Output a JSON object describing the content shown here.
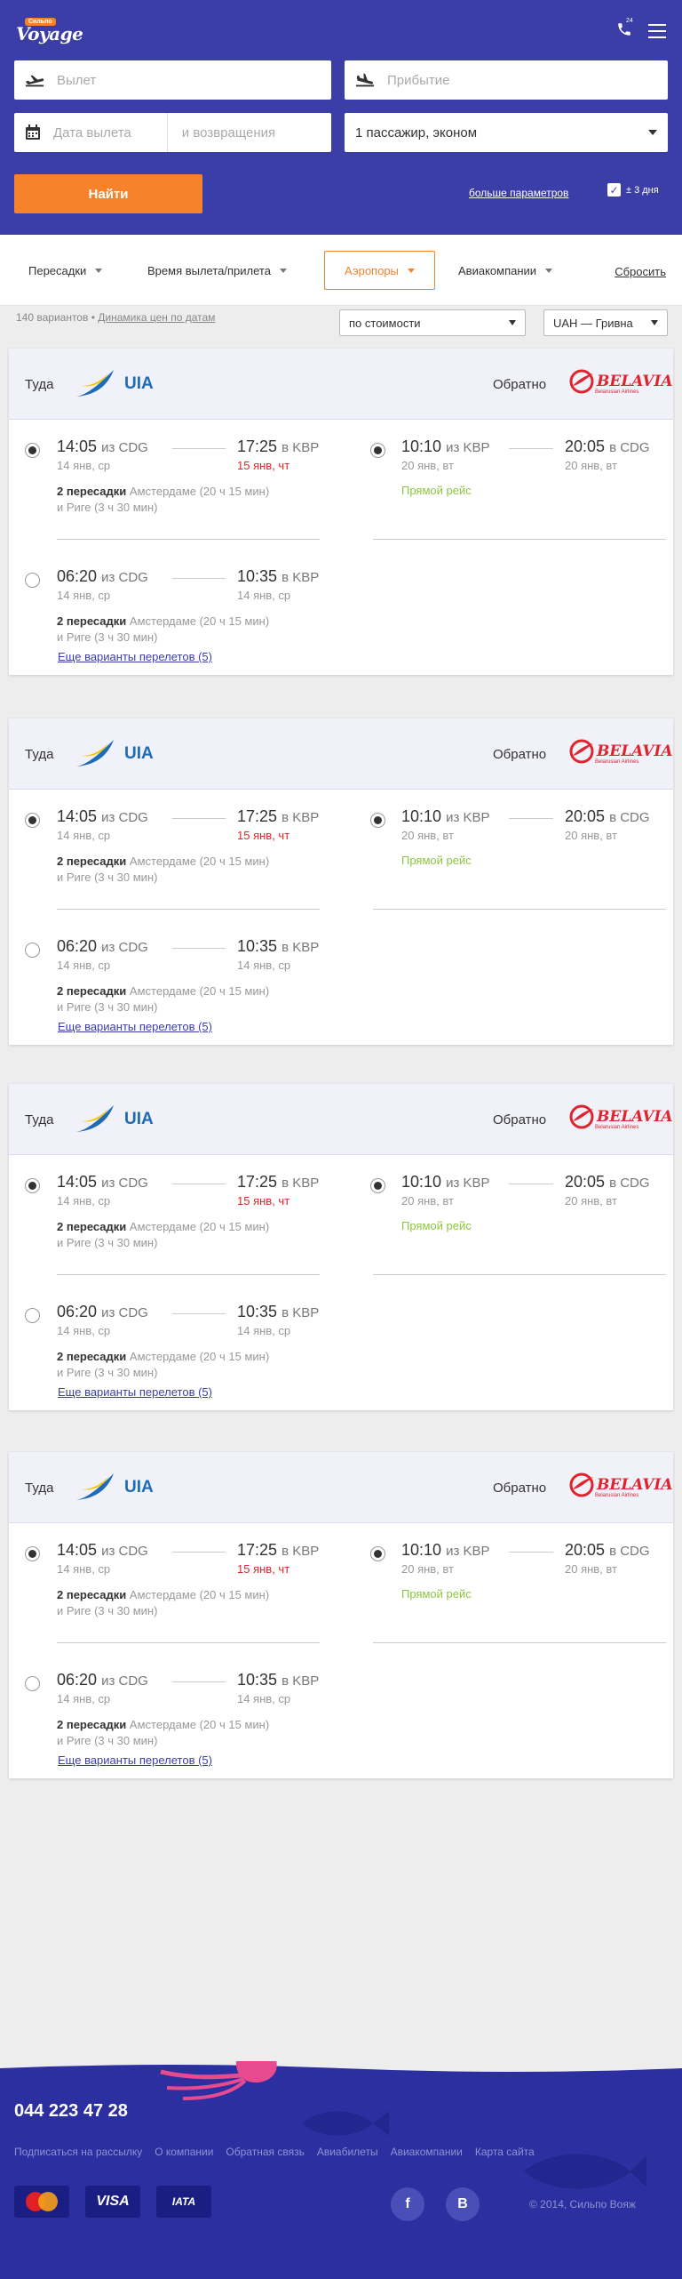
{
  "header": {
    "logo_text": "Voyage",
    "logo_flag": "Сильпо",
    "phone_badge": "24",
    "depart_placeholder": "Вылет",
    "arrive_placeholder": "Прибытие",
    "date_from_placeholder": "Дата вылета",
    "date_back_placeholder": "и возвращения",
    "passengers_value": "1 пассажир, эконом",
    "find_label": "Найти",
    "more_params_label": "больше параметров",
    "plus_minus_label": "± 3 дня"
  },
  "filters": {
    "items": [
      "Пересадки",
      "Время вылета/прилета",
      "Аэропоры",
      "Авиакомпании"
    ],
    "active_index": 2,
    "reset_label": "Сбросить"
  },
  "results": {
    "count_text": "140 вариантов",
    "dynamics_link": "Динамика цен по датам",
    "sort_value": "по стоимости",
    "currency_value": "UAH — Гривна"
  },
  "cards": [
    {
      "there_label": "Туда",
      "back_label": "Обратно",
      "airline_out": "UIA",
      "airline_back": "BELAVIA",
      "airline_back_sub": "Belarusian Airlines",
      "flight_a": {
        "dep_time": "14:05",
        "dep_from": "из CDG",
        "dep_date": "14 янв, ср",
        "arr_time": "17:25",
        "arr_to": "в KBP",
        "arr_date": "15 янв, чт",
        "stops_bold": "2 пересадки",
        "stops_text": "Амстердаме (20 ч  15 мин)",
        "stops_text2": "и Риге (3 ч 30 мин)"
      },
      "flight_b": {
        "dep_time": "06:20",
        "dep_from": "из CDG",
        "dep_date": "14 янв, ср",
        "arr_time": "10:35",
        "arr_to": "в KBP",
        "arr_date": "14 янв, ср",
        "stops_bold": "2 пересадки",
        "stops_text": "Амстердаме (20 ч  15 мин)",
        "stops_text2": "и Риге (3 ч 30 мин)"
      },
      "return": {
        "dep_time": "10:10",
        "dep_from": "из KBP",
        "dep_date": "20 янв, вт",
        "arr_time": "20:05",
        "arr_to": "в CDG",
        "arr_date": "20 янв, вт",
        "direct": "Прямой рейс"
      },
      "more_link": "Еще варианты перелетов (5)"
    },
    {
      "there_label": "Туда",
      "back_label": "Обратно",
      "airline_out": "UIA",
      "airline_back": "BELAVIA",
      "airline_back_sub": "Belarusian Airlines",
      "flight_a": {
        "dep_time": "14:05",
        "dep_from": "из CDG",
        "dep_date": "14 янв, ср",
        "arr_time": "17:25",
        "arr_to": "в KBP",
        "arr_date": "15 янв, чт",
        "stops_bold": "2 пересадки",
        "stops_text": "Амстердаме (20 ч  15 мин)",
        "stops_text2": "и Риге (3 ч 30 мин)"
      },
      "flight_b": {
        "dep_time": "06:20",
        "dep_from": "из CDG",
        "dep_date": "14 янв, ср",
        "arr_time": "10:35",
        "arr_to": "в KBP",
        "arr_date": "14 янв, ср",
        "stops_bold": "2 пересадки",
        "stops_text": "Амстердаме (20 ч  15 мин)",
        "stops_text2": "и Риге (3 ч 30 мин)"
      },
      "return": {
        "dep_time": "10:10",
        "dep_from": "из KBP",
        "dep_date": "20 янв, вт",
        "arr_time": "20:05",
        "arr_to": "в CDG",
        "arr_date": "20 янв, вт",
        "direct": "Прямой рейс"
      },
      "more_link": "Еще варианты перелетов (5)"
    },
    {
      "there_label": "Туда",
      "back_label": "Обратно",
      "airline_out": "UIA",
      "airline_back": "BELAVIA",
      "airline_back_sub": "Belarusian Airlines",
      "flight_a": {
        "dep_time": "14:05",
        "dep_from": "из CDG",
        "dep_date": "14 янв, ср",
        "arr_time": "17:25",
        "arr_to": "в KBP",
        "arr_date": "15 янв, чт",
        "stops_bold": "2 пересадки",
        "stops_text": "Амстердаме (20 ч  15 мин)",
        "stops_text2": "и Риге (3 ч 30 мин)"
      },
      "flight_b": {
        "dep_time": "06:20",
        "dep_from": "из CDG",
        "dep_date": "14 янв, ср",
        "arr_time": "10:35",
        "arr_to": "в KBP",
        "arr_date": "14 янв, ср",
        "stops_bold": "2 пересадки",
        "stops_text": "Амстердаме (20 ч  15 мин)",
        "stops_text2": "и Риге (3 ч 30 мин)"
      },
      "return": {
        "dep_time": "10:10",
        "dep_from": "из KBP",
        "dep_date": "20 янв, вт",
        "arr_time": "20:05",
        "arr_to": "в CDG",
        "arr_date": "20 янв, вт",
        "direct": "Прямой рейс"
      },
      "more_link": "Еще варианты перелетов (5)"
    },
    {
      "there_label": "Туда",
      "back_label": "Обратно",
      "airline_out": "UIA",
      "airline_back": "BELAVIA",
      "airline_back_sub": "Belarusian Airlines",
      "flight_a": {
        "dep_time": "14:05",
        "dep_from": "из CDG",
        "dep_date": "14 янв, ср",
        "arr_time": "17:25",
        "arr_to": "в KBP",
        "arr_date": "15 янв, чт",
        "stops_bold": "2 пересадки",
        "stops_text": "Амстердаме (20 ч  15 мин)",
        "stops_text2": "и Риге (3 ч 30 мин)"
      },
      "flight_b": {
        "dep_time": "06:20",
        "dep_from": "из CDG",
        "dep_date": "14 янв, ср",
        "arr_time": "10:35",
        "arr_to": "в KBP",
        "arr_date": "14 янв, ср",
        "stops_bold": "2 пересадки",
        "stops_text": "Амстердаме (20 ч  15 мин)",
        "stops_text2": "и Риге (3 ч 30 мин)"
      },
      "return": {
        "dep_time": "10:10",
        "dep_from": "из KBP",
        "dep_date": "20 янв, вт",
        "arr_time": "20:05",
        "arr_to": "в CDG",
        "arr_date": "20 янв, вт",
        "direct": "Прямой рейс"
      },
      "more_link": "Еще варианты перелетов (5)"
    }
  ],
  "footer": {
    "phone": "044 223 47 28",
    "links": [
      "Подписаться на рассылку",
      "О компании",
      "Обратная связь",
      "Авиабилеты",
      "Авиакомпании",
      "Карта сайта"
    ],
    "payment": [
      "MasterCard",
      "VISA",
      "IATA"
    ],
    "social": [
      "f",
      "B"
    ],
    "copyright": "© 2014, Сильпо Вояж"
  },
  "colors": {
    "brand": "#3c3ea8",
    "accent": "#f6822a",
    "footer": "#2b2fa0",
    "late": "#e0242e",
    "direct": "#8cc63f"
  }
}
